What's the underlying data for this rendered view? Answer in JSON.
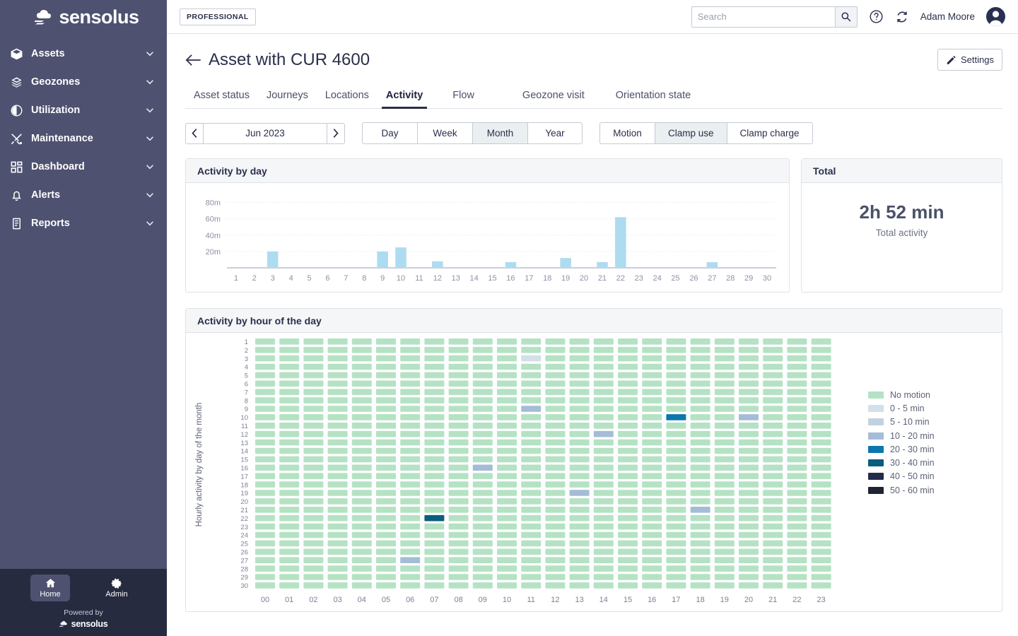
{
  "sidebar": {
    "logo_text": "sensolus",
    "items": [
      {
        "label": "Assets",
        "icon": "box-icon"
      },
      {
        "label": "Geozones",
        "icon": "layers-icon"
      },
      {
        "label": "Utilization",
        "icon": "pie-clock-icon"
      },
      {
        "label": "Maintenance",
        "icon": "tools-icon"
      },
      {
        "label": "Dashboard",
        "icon": "grid-icon"
      },
      {
        "label": "Alerts",
        "icon": "bell-icon"
      },
      {
        "label": "Reports",
        "icon": "document-icon"
      }
    ],
    "bottom": {
      "home_label": "Home",
      "admin_label": "Admin",
      "powered_by": "Powered by",
      "powered_brand": "sensolus"
    }
  },
  "topbar": {
    "plan_badge": "PROFESSIONAL",
    "search_placeholder": "Search",
    "search_value": "",
    "user_name": "Adam Moore",
    "help_icon": "question-circle-icon",
    "refresh_icon": "refresh-icon",
    "avatar_icon": "user-avatar-icon"
  },
  "page": {
    "title": "Asset with CUR 4600",
    "back_icon": "arrow-left-icon",
    "settings_label": "Settings",
    "settings_icon": "pencil-icon"
  },
  "tabs": [
    {
      "label": "Asset status",
      "active": false
    },
    {
      "label": "Journeys",
      "active": false
    },
    {
      "label": "Locations",
      "active": false
    },
    {
      "label": "Activity",
      "active": true
    },
    {
      "label": "Flow",
      "active": false
    },
    {
      "label": "Geozone visit",
      "active": false
    },
    {
      "label": "Orientation state",
      "active": false
    }
  ],
  "controls": {
    "prev_icon": "chevron-left-icon",
    "next_icon": "chevron-right-icon",
    "period_label": "Jun 2023",
    "range_options": [
      {
        "label": "Day",
        "active": false
      },
      {
        "label": "Week",
        "active": false
      },
      {
        "label": "Month",
        "active": true
      },
      {
        "label": "Year",
        "active": false
      }
    ],
    "metric_options": [
      {
        "label": "Motion",
        "active": false
      },
      {
        "label": "Clamp use",
        "active": true
      },
      {
        "label": "Clamp charge",
        "active": false
      }
    ]
  },
  "cards": {
    "activity_by_day_title": "Activity by day",
    "total_title": "Total",
    "total_value": "2h 52 min",
    "total_sub": "Total activity",
    "activity_by_hour_title": "Activity by hour of the day"
  },
  "chart_data": [
    {
      "type": "bar",
      "title": "Activity by day",
      "xlabel": "",
      "ylabel": "",
      "ylim": [
        0,
        90
      ],
      "yticks": [
        20,
        40,
        60,
        80
      ],
      "ytick_labels": [
        "20m",
        "40m",
        "60m",
        "80m"
      ],
      "grid": true,
      "bar_color": "#addcf0",
      "categories": [
        "1",
        "2",
        "3",
        "4",
        "5",
        "6",
        "7",
        "8",
        "9",
        "10",
        "11",
        "12",
        "13",
        "14",
        "15",
        "16",
        "17",
        "18",
        "19",
        "20",
        "21",
        "22",
        "23",
        "24",
        "25",
        "26",
        "27",
        "28",
        "29",
        "30"
      ],
      "values": [
        0,
        0,
        20,
        0,
        0,
        0,
        0,
        0,
        20,
        25,
        0,
        8,
        0,
        0,
        0,
        7,
        0,
        0,
        12,
        0,
        7,
        62,
        0,
        0,
        0,
        0,
        7,
        0,
        0,
        0
      ],
      "unit": "minutes"
    },
    {
      "type": "heatmap",
      "title": "Activity by hour of the day",
      "xlabel": "",
      "ylabel": "Hourly activity by day of the month",
      "x_categories": [
        "00",
        "01",
        "02",
        "03",
        "04",
        "05",
        "06",
        "07",
        "08",
        "09",
        "10",
        "11",
        "12",
        "13",
        "14",
        "15",
        "16",
        "17",
        "18",
        "19",
        "20",
        "21",
        "22",
        "23"
      ],
      "y_categories": [
        "1",
        "2",
        "3",
        "4",
        "5",
        "6",
        "7",
        "8",
        "9",
        "10",
        "11",
        "12",
        "13",
        "14",
        "15",
        "16",
        "17",
        "18",
        "19",
        "20",
        "21",
        "22",
        "23",
        "24",
        "25",
        "26",
        "27",
        "28",
        "29",
        "30"
      ],
      "default_bucket": 0,
      "legend_position": "right",
      "legend": [
        {
          "label": "No motion",
          "color": "#b5e2c4"
        },
        {
          "label": "0 - 5 min",
          "color": "#d3dfe9"
        },
        {
          "label": "5 - 10 min",
          "color": "#c0d2e0"
        },
        {
          "label": "10 - 20 min",
          "color": "#a5bcd6"
        },
        {
          "label": "20 - 30 min",
          "color": "#0b77ad"
        },
        {
          "label": "30 - 40 min",
          "color": "#0c5c7c"
        },
        {
          "label": "40 - 50 min",
          "color": "#252a4a"
        },
        {
          "label": "50 - 60 min",
          "color": "#1f2433"
        }
      ],
      "cells": [
        {
          "day": 3,
          "hour": 11,
          "bucket": 1
        },
        {
          "day": 9,
          "hour": 11,
          "bucket": 3
        },
        {
          "day": 10,
          "hour": 17,
          "bucket": 4
        },
        {
          "day": 10,
          "hour": 20,
          "bucket": 3
        },
        {
          "day": 12,
          "hour": 14,
          "bucket": 3
        },
        {
          "day": 16,
          "hour": 9,
          "bucket": 3
        },
        {
          "day": 19,
          "hour": 13,
          "bucket": 3
        },
        {
          "day": 21,
          "hour": 18,
          "bucket": 3
        },
        {
          "day": 22,
          "hour": 7,
          "bucket": 5
        },
        {
          "day": 27,
          "hour": 6,
          "bucket": 3
        }
      ]
    }
  ]
}
